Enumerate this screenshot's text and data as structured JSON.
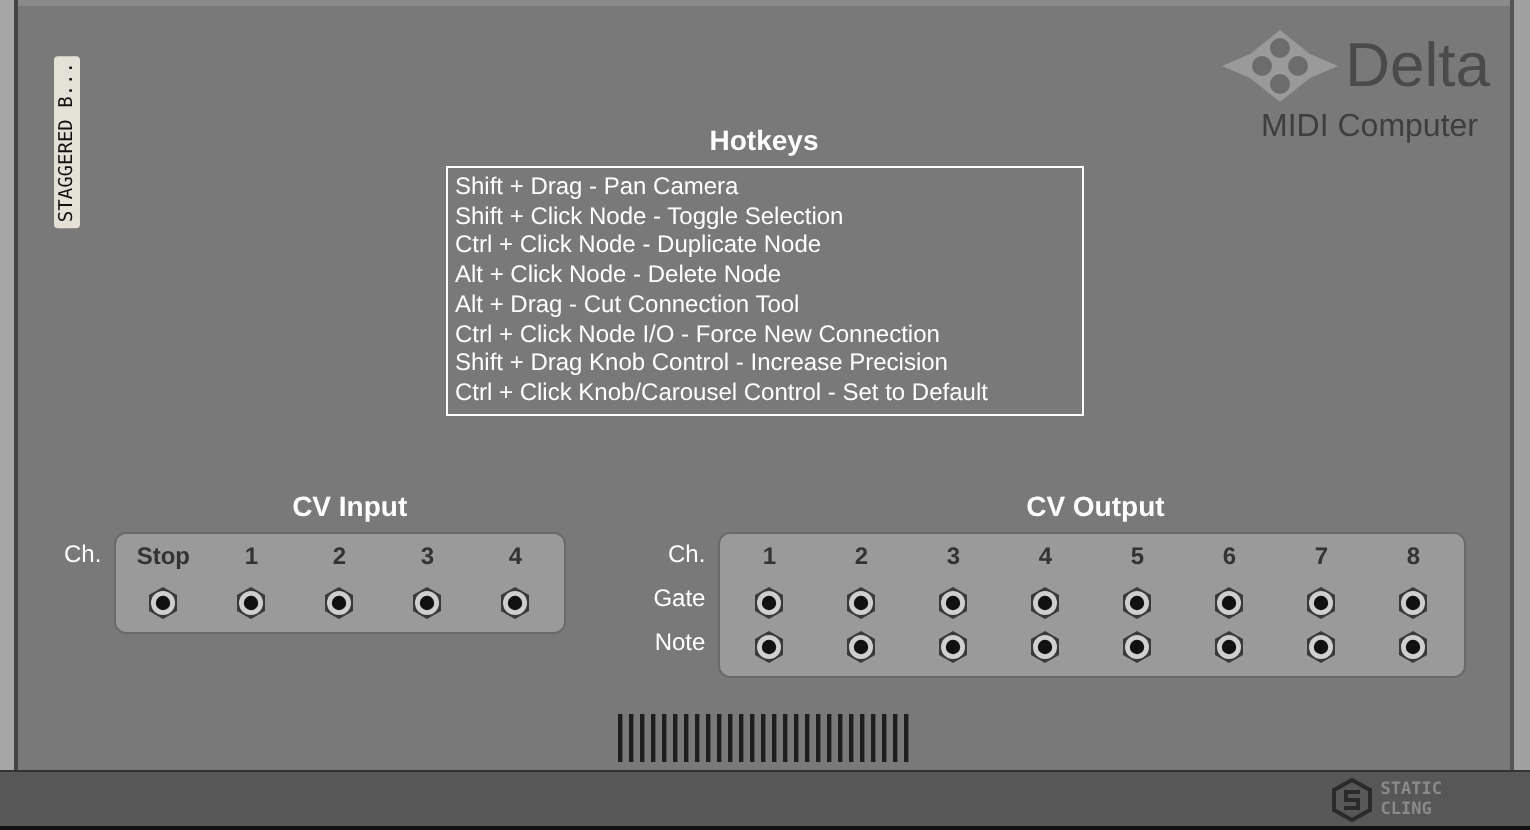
{
  "tag": "STAGGERED B...",
  "logo": {
    "name": "Delta",
    "subtitle": "MIDI Computer"
  },
  "hotkeys": {
    "title": "Hotkeys",
    "items": [
      "Shift + Drag - Pan Camera",
      "Shift + Click Node - Toggle Selection",
      "Ctrl + Click Node - Duplicate Node",
      "Alt + Click Node - Delete Node",
      "Alt + Drag - Cut Connection Tool",
      "Ctrl + Click Node I/O - Force New Connection",
      "Shift + Drag Knob Control - Increase Precision",
      "Ctrl + Click Knob/Carousel Control - Set to Default"
    ]
  },
  "cv_input": {
    "title": "CV Input",
    "row_label": "Ch.",
    "channels": [
      "Stop",
      "1",
      "2",
      "3",
      "4"
    ]
  },
  "cv_output": {
    "title": "CV Output",
    "row_labels": [
      "Ch.",
      "Gate",
      "Note"
    ],
    "channels": [
      "1",
      "2",
      "3",
      "4",
      "5",
      "6",
      "7",
      "8"
    ]
  },
  "footer": {
    "brand": [
      "STATIC",
      "CLING"
    ]
  }
}
